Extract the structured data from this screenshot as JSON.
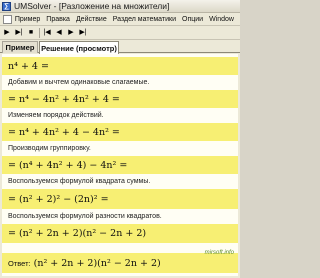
{
  "window": {
    "title": "UMSolver - [Разложение на множители]",
    "app_icon": "calculator-icon"
  },
  "menu": {
    "items": [
      "Пример",
      "Правка",
      "Действие",
      "Раздел математики",
      "Опции",
      "Window"
    ]
  },
  "toolbar": {
    "buttons": [
      "play-icon",
      "step-icon",
      "stop-icon",
      "first-icon",
      "prev-icon",
      "next-icon",
      "last-icon"
    ]
  },
  "tabs": {
    "example": "Пример",
    "solution": "Решение (просмотр)"
  },
  "solution": {
    "lines": [
      {
        "kind": "eq",
        "text": "n⁴ + 4 ="
      },
      {
        "kind": "note",
        "text": "Добавим и вычтем одинаковые слагаемые."
      },
      {
        "kind": "eq",
        "text": "= n⁴ − 4n² + 4n² + 4 ="
      },
      {
        "kind": "note",
        "text": "Изменяем порядок действий."
      },
      {
        "kind": "eq",
        "text": "= n⁴ + 4n² + 4 − 4n² ="
      },
      {
        "kind": "note",
        "text": "Производим группировку."
      },
      {
        "kind": "eq",
        "text": "= (n⁴ + 4n² + 4) − 4n² ="
      },
      {
        "kind": "note",
        "text": "Воспользуемся формулой квадрата суммы."
      },
      {
        "kind": "eq",
        "text": "= (n² + 2)² − (2n)² ="
      },
      {
        "kind": "note",
        "text": "Воспользуемся формулой разности квадратов."
      },
      {
        "kind": "eq",
        "text": "= (n² + 2n + 2)(n² − 2n + 2)"
      }
    ],
    "answer_label": "Ответ:",
    "answer": "(n² + 2n + 2)(n² − 2n + 2)"
  },
  "watermark": "mirsoft.info"
}
